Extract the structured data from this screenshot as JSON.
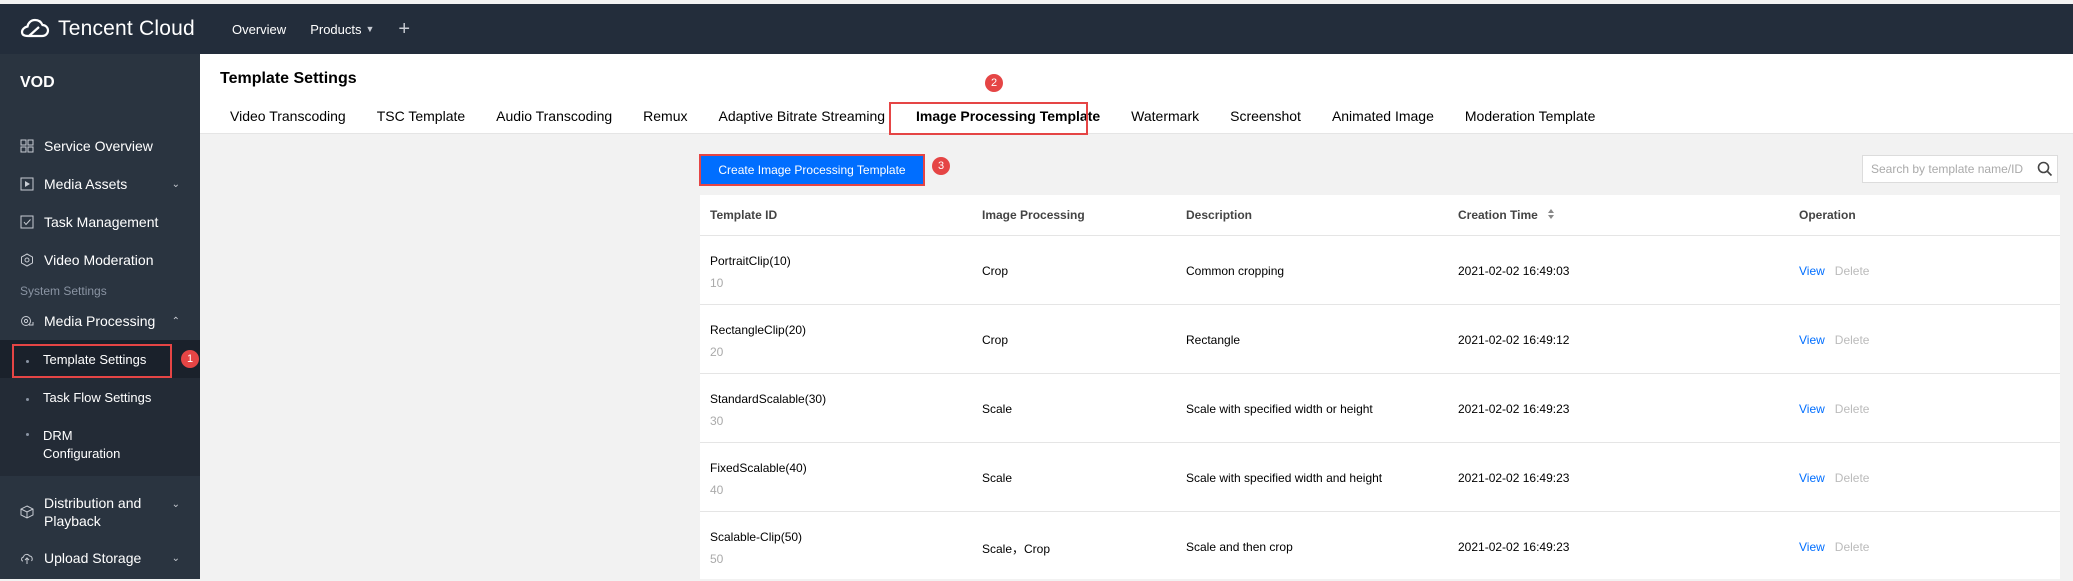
{
  "topbar": {
    "logo_text": "Tencent Cloud",
    "nav": [
      {
        "label": "Overview"
      },
      {
        "label": "Products"
      }
    ],
    "plus": "+"
  },
  "sidebar": {
    "title": "VOD",
    "items": [
      {
        "label": "Service Overview",
        "icon": "grid-icon"
      },
      {
        "label": "Media Assets",
        "icon": "play-icon",
        "chevron": "⌄"
      },
      {
        "label": "Task Management",
        "icon": "check-square-icon"
      },
      {
        "label": "Video Moderation",
        "icon": "shield-icon"
      }
    ],
    "group_label": "System Settings",
    "media_processing": {
      "label": "Media Processing",
      "icon": "gear-cloud-icon",
      "chevron": "⌃"
    },
    "subitems": [
      {
        "label": "Template Settings"
      },
      {
        "label": "Task Flow Settings"
      },
      {
        "label": "DRM Configuration"
      }
    ],
    "bottom_items": [
      {
        "label": "Distribution and Playback",
        "icon": "cube-icon",
        "chevron": "⌄"
      },
      {
        "label": "Upload Storage",
        "icon": "upload-icon",
        "chevron": "⌄"
      }
    ]
  },
  "badges": {
    "one": "1",
    "two": "2",
    "three": "3"
  },
  "header": {
    "title": "Template Settings",
    "tabs": [
      {
        "label": "Video Transcoding"
      },
      {
        "label": "TSC Template"
      },
      {
        "label": "Audio Transcoding"
      },
      {
        "label": "Remux"
      },
      {
        "label": "Adaptive Bitrate Streaming"
      },
      {
        "label": "Image Processing Template"
      },
      {
        "label": "Watermark"
      },
      {
        "label": "Screenshot"
      },
      {
        "label": "Animated Image"
      },
      {
        "label": "Moderation Template"
      }
    ],
    "active_tab": "Image Processing Template"
  },
  "toolbar": {
    "create_label": "Create Image Processing Template",
    "search_placeholder": "Search by template name/ID"
  },
  "table": {
    "columns": [
      "Template ID",
      "Image Processing",
      "Description",
      "Creation Time",
      "Operation"
    ],
    "sort_icon": "sort-icon",
    "rows": [
      {
        "name": "PortraitClip(10)",
        "id": "10",
        "processing": "Crop",
        "description": "Common cropping",
        "time": "2021-02-02 16:49:03",
        "view": "View",
        "delete": "Delete"
      },
      {
        "name": "RectangleClip(20)",
        "id": "20",
        "processing": "Crop",
        "description": "Rectangle",
        "time": "2021-02-02 16:49:12",
        "view": "View",
        "delete": "Delete"
      },
      {
        "name": "StandardScalable(30)",
        "id": "30",
        "processing": "Scale",
        "description": "Scale with specified width or height",
        "time": "2021-02-02 16:49:23",
        "view": "View",
        "delete": "Delete"
      },
      {
        "name": "FixedScalable(40)",
        "id": "40",
        "processing": "Scale",
        "description": "Scale with specified width and height",
        "time": "2021-02-02 16:49:23",
        "view": "View",
        "delete": "Delete"
      },
      {
        "name": "Scalable-Clip(50)",
        "id": "50",
        "processing": "Scale，Crop",
        "description": "Scale and then crop",
        "time": "2021-02-02 16:49:23",
        "view": "View",
        "delete": "Delete"
      }
    ]
  },
  "colors": {
    "accent": "#006eff",
    "highlight": "#e54545",
    "topbar": "#232d3b",
    "sidebar": "#2a3440"
  }
}
